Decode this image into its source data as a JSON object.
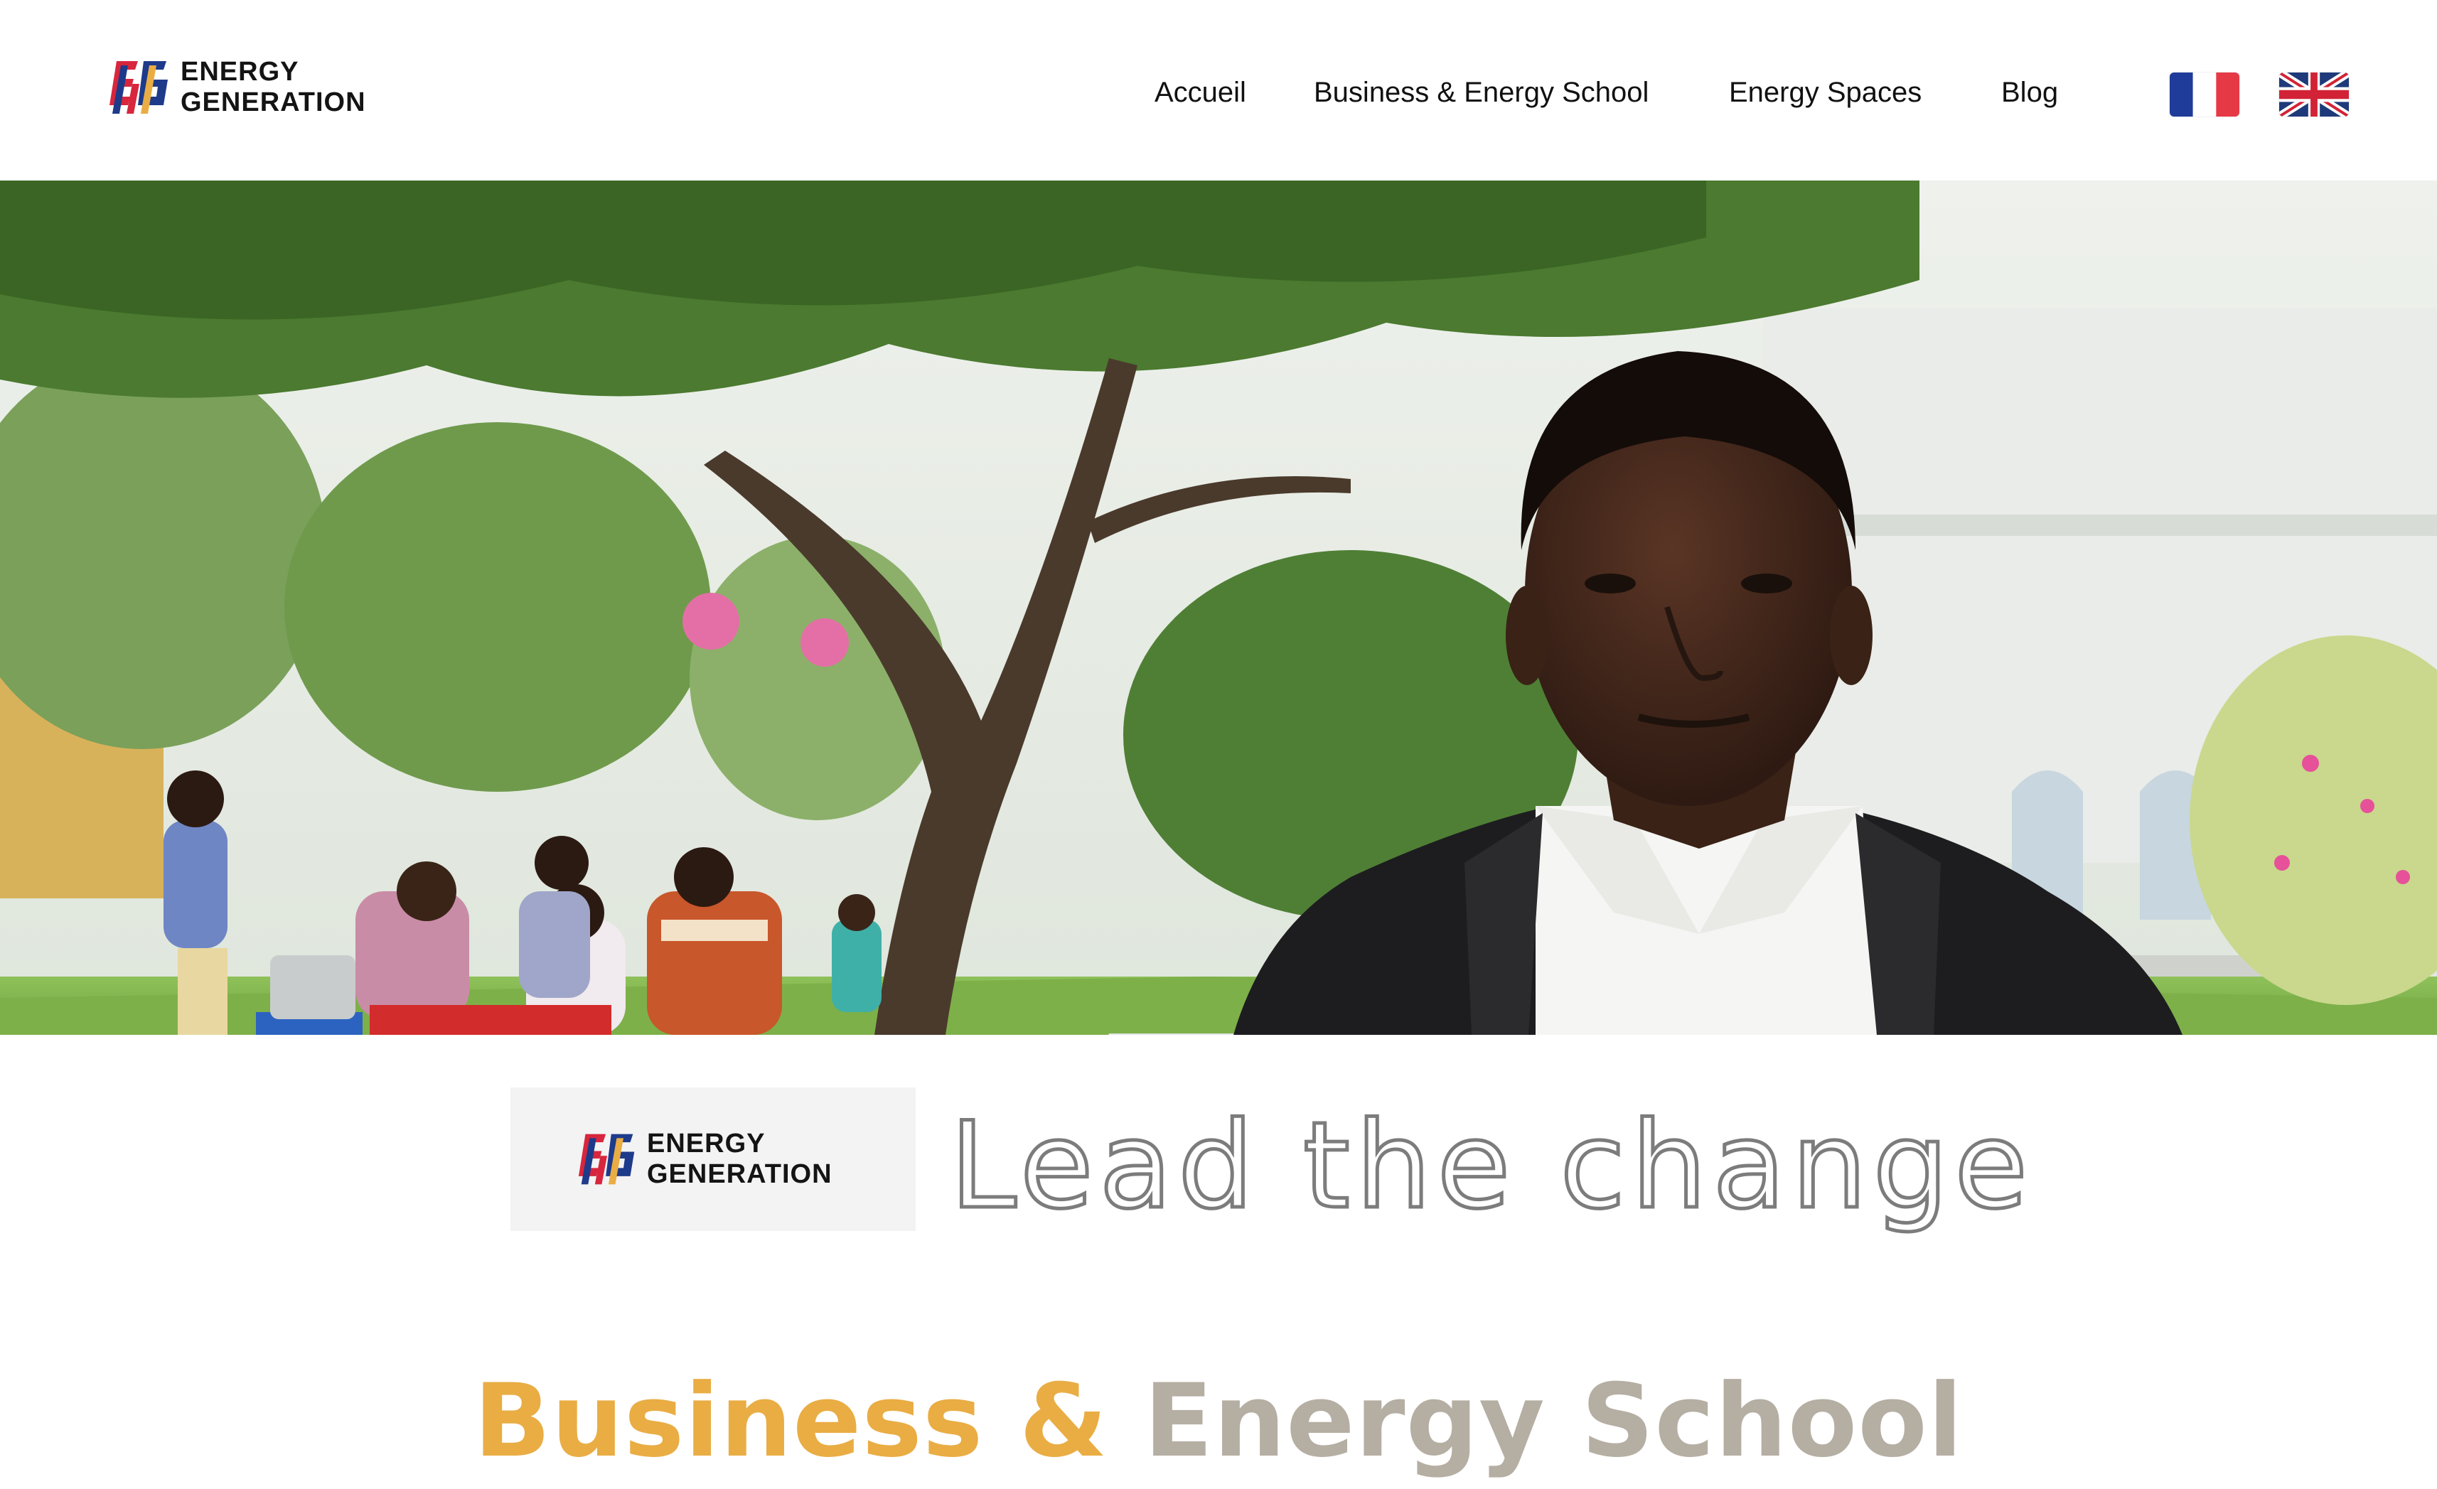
{
  "brand": {
    "logo_line1": "ENERGY",
    "logo_line2": "GENERATION",
    "mark_colors": [
      "#d7263d",
      "#1e3a8a",
      "#e9ad44"
    ]
  },
  "nav": {
    "items": [
      {
        "label": "Accueil"
      },
      {
        "label": "Business & Energy School"
      },
      {
        "label": "Energy Spaces"
      },
      {
        "label": "Blog"
      }
    ]
  },
  "languages": [
    {
      "name": "french-flag-icon"
    },
    {
      "name": "uk-flag-icon"
    }
  ],
  "hero": {
    "image": "photo-young-man-in-suit-outdoors-with-people-at-table-under-trees"
  },
  "section": {
    "tagline": "Lead the change",
    "heading_part1": "Business &",
    "heading_part2": "Energy School"
  },
  "colors": {
    "accent_orange": "#e9ad44",
    "accent_gray": "#b5aea3",
    "tagline_stroke": "#7c7c7c"
  }
}
